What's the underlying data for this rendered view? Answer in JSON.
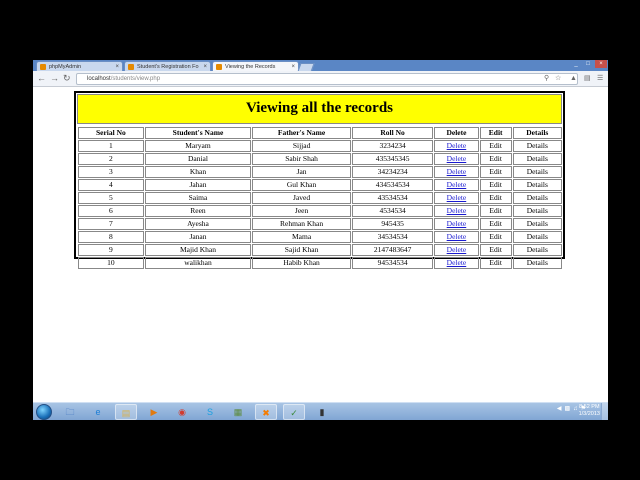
{
  "browser": {
    "tabs": [
      {
        "label": "phpMyAdmin",
        "fav_color": "#e58a00",
        "active": false
      },
      {
        "label": "Student's Registration Fo",
        "fav_color": "#e58a00",
        "active": false
      },
      {
        "label": "Viewing the Records",
        "fav_color": "#e58a00",
        "active": true
      }
    ],
    "tab_close": "×",
    "url_host": "localhost",
    "url_path": "/students/view.php",
    "window_buttons": [
      "_",
      "□",
      "×"
    ]
  },
  "page": {
    "title": "Viewing all the records",
    "columns": [
      "Serial No",
      "Student's Name",
      "Father's Name",
      "Roll No",
      "Delete",
      "Edit",
      "Details"
    ],
    "rows": [
      {
        "serial": "1",
        "student": "Maryam",
        "father": "Sijjad",
        "roll": "3234234",
        "delete": "Delete",
        "edit": "Edit",
        "details": "Details"
      },
      {
        "serial": "2",
        "student": "Danial",
        "father": "Sabir Shah",
        "roll": "435345345",
        "delete": "Delete",
        "edit": "Edit",
        "details": "Details"
      },
      {
        "serial": "3",
        "student": "Khan",
        "father": "Jan",
        "roll": "34234234",
        "delete": "Delete",
        "edit": "Edit",
        "details": "Details"
      },
      {
        "serial": "4",
        "student": "Jahan",
        "father": "Gul Khan",
        "roll": "434534534",
        "delete": "Delete",
        "edit": "Edit",
        "details": "Details"
      },
      {
        "serial": "5",
        "student": "Saima",
        "father": "Javed",
        "roll": "43534534",
        "delete": "Delete",
        "edit": "Edit",
        "details": "Details"
      },
      {
        "serial": "6",
        "student": "Reen",
        "father": "Jeen",
        "roll": "4534534",
        "delete": "Delete",
        "edit": "Edit",
        "details": "Details"
      },
      {
        "serial": "7",
        "student": "Ayesha",
        "father": "Rehman Khan",
        "roll": "945435",
        "delete": "Delete",
        "edit": "Edit",
        "details": "Details"
      },
      {
        "serial": "8",
        "student": "Janan",
        "father": "Mama",
        "roll": "34534534",
        "delete": "Delete",
        "edit": "Edit",
        "details": "Details"
      },
      {
        "serial": "9",
        "student": "Majid Khan",
        "father": "Sajid Khan",
        "roll": "2147483647",
        "delete": "Delete",
        "edit": "Edit",
        "details": "Details"
      },
      {
        "serial": "10",
        "student": "walikhan",
        "father": "Habib Khan",
        "roll": "94534534",
        "delete": "Delete",
        "edit": "Edit",
        "details": "Details"
      }
    ],
    "title_bg": "#ffff00",
    "link_color": "#1a1ad0"
  },
  "taskbar": {
    "apps": [
      {
        "name": "windows-explorer-icon",
        "glyph": "🗀",
        "color": "#3a6fbf"
      },
      {
        "name": "internet-explorer-icon",
        "glyph": "e",
        "color": "#1e7fd6"
      },
      {
        "name": "folder-icon",
        "glyph": "▤",
        "color": "#d9b24c"
      },
      {
        "name": "media-player-icon",
        "glyph": "▶",
        "color": "#e07a10"
      },
      {
        "name": "chrome-icon",
        "glyph": "◉",
        "color": "#d23b2e"
      },
      {
        "name": "skype-icon",
        "glyph": "S",
        "color": "#1aa0e0"
      },
      {
        "name": "app-icon",
        "glyph": "▦",
        "color": "#5c8a3a"
      },
      {
        "name": "xampp-icon",
        "glyph": "✖",
        "color": "#f57c00"
      },
      {
        "name": "app2-icon",
        "glyph": "✓",
        "color": "#3c8a3c"
      },
      {
        "name": "app3-icon",
        "glyph": "▮",
        "color": "#333333"
      }
    ],
    "time": "8:52 PM",
    "date": "1/3/2013"
  }
}
